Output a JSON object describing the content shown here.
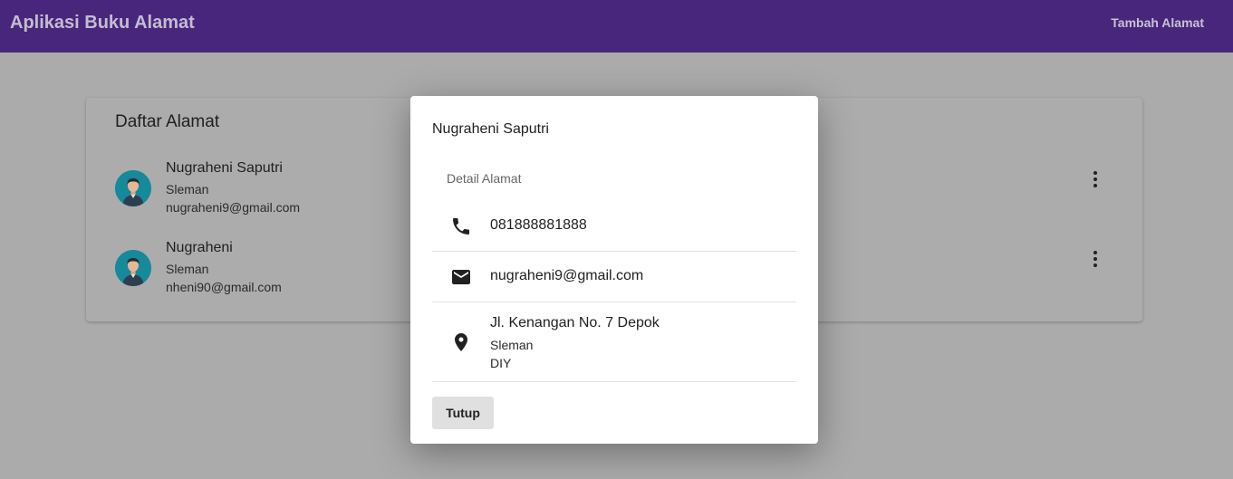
{
  "appbar": {
    "title": "Aplikasi Buku Alamat",
    "action_label": "Tambah Alamat",
    "color": "#48267c"
  },
  "list": {
    "title": "Daftar Alamat",
    "items": [
      {
        "name": "Nugraheni Saputri",
        "city": "Sleman",
        "email": "nugraheni9@gmail.com",
        "avatar_icon": "person-avatar-icon",
        "menu_icon": "more-vert-icon"
      },
      {
        "name": "Nugraheni",
        "city": "Sleman",
        "email": "nheni90@gmail.com",
        "avatar_icon": "person-avatar-icon",
        "menu_icon": "more-vert-icon"
      }
    ]
  },
  "dialog": {
    "title": "Nugraheni Saputri",
    "subheader": "Detail Alamat",
    "phone": {
      "icon": "phone-icon",
      "value": "081888881888"
    },
    "email": {
      "icon": "email-icon",
      "value": "nugraheni9@gmail.com"
    },
    "address": {
      "icon": "location-pin-icon",
      "street": "Jl. Kenangan No. 7 Depok",
      "city": "Sleman",
      "province": "DIY"
    },
    "close_label": "Tutup"
  }
}
